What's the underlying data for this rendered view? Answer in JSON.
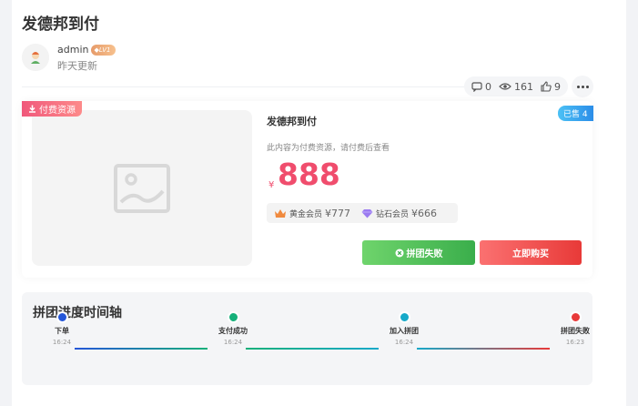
{
  "post": {
    "title": "发德邦到付",
    "author": "admin",
    "level": "LV1",
    "updated": "昨天更新",
    "stats": {
      "comments": "0",
      "views": "161",
      "likes": "9"
    }
  },
  "resource": {
    "tag": "付费资源",
    "title": "发德邦到付",
    "sold_badge": "已售 4",
    "note": "此内容为付费资源，请付费后查看",
    "currency": "¥",
    "price": "888",
    "vip": [
      {
        "name": "黄金会员",
        "price": "¥777",
        "color": "#f08a3e"
      },
      {
        "name": "钻石会员",
        "price": "¥666",
        "color": "#9b7bf0"
      }
    ],
    "btn_fail": "拼团失败",
    "btn_buy": "立即购买"
  },
  "timeline": {
    "title": "拼团进度时间轴",
    "steps": [
      {
        "label": "下单",
        "time": "16:24",
        "color": "#2456d8"
      },
      {
        "label": "支付成功",
        "time": "16:24",
        "color": "#16b07a"
      },
      {
        "label": "加入拼团",
        "time": "16:24",
        "color": "#16a9c9"
      },
      {
        "label": "拼团失败",
        "time": "16:23",
        "color": "#e83a3a"
      }
    ]
  }
}
